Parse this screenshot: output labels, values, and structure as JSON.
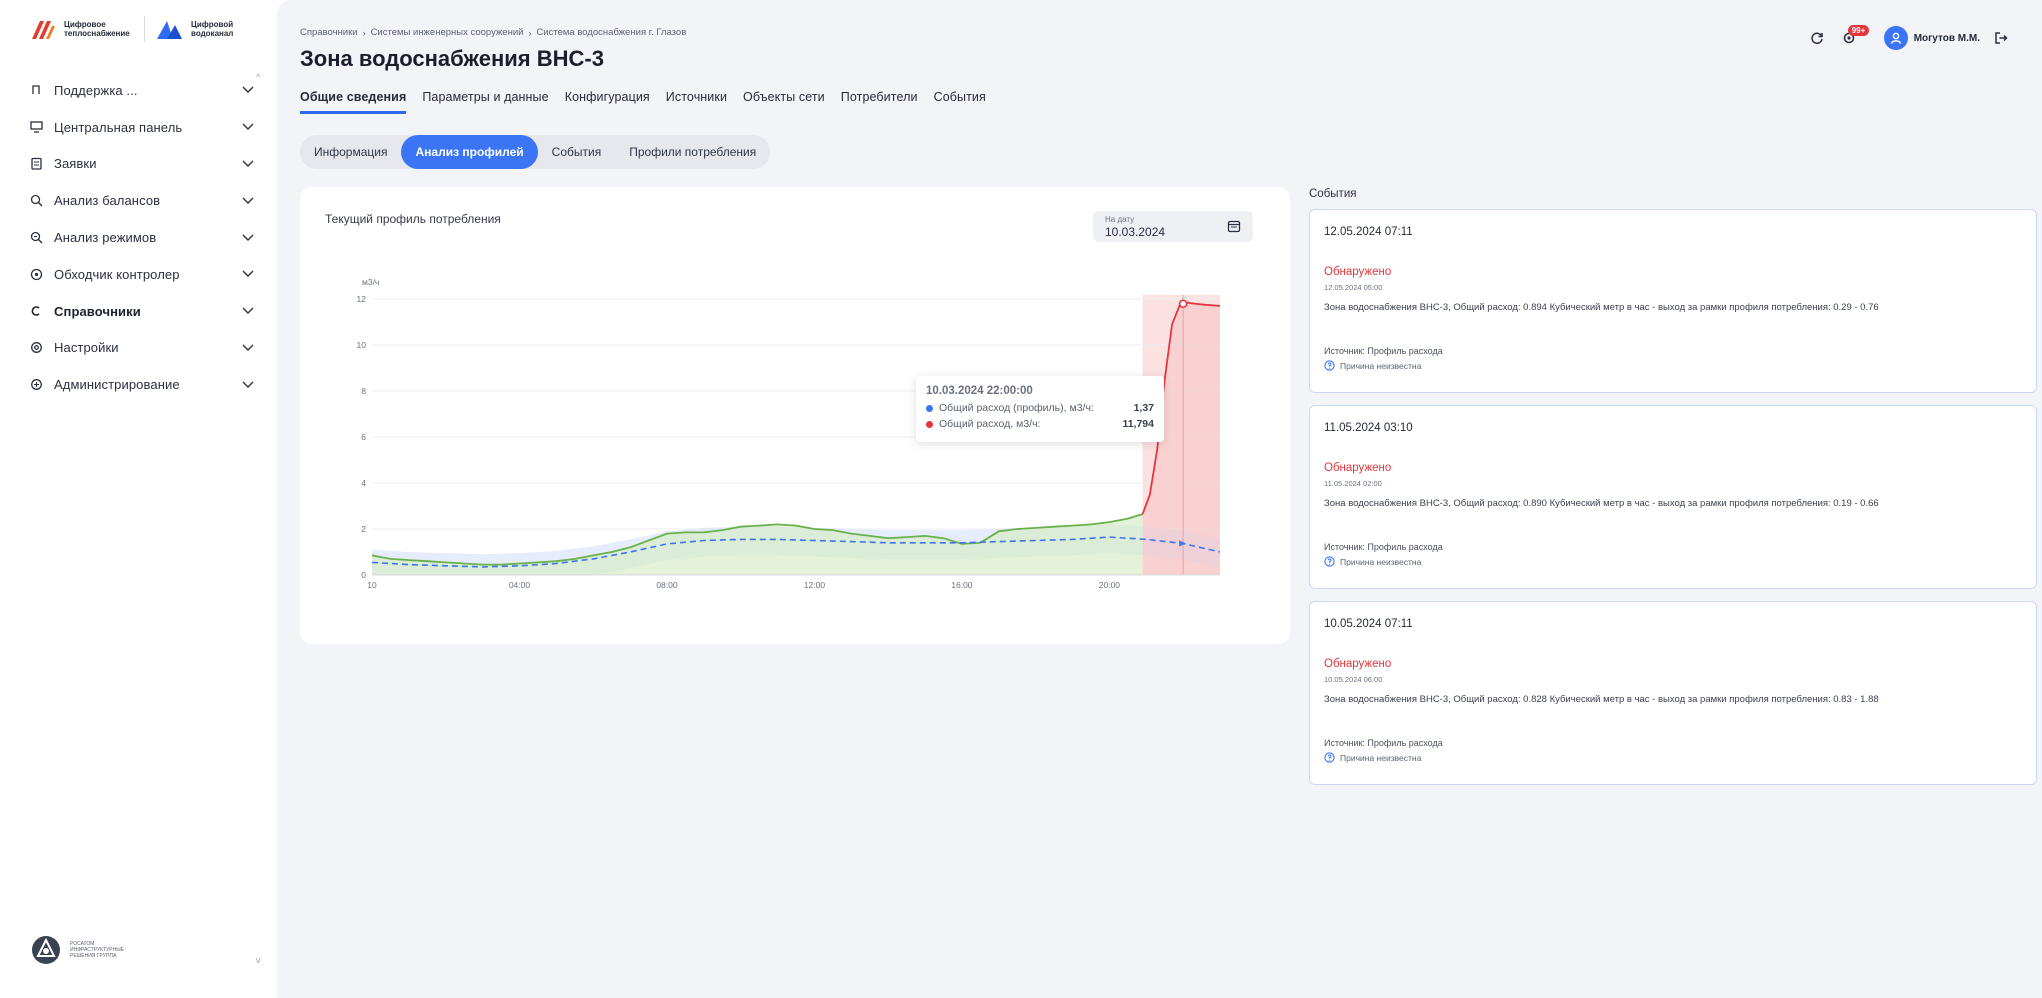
{
  "brand": {
    "logo1_text": "Цифровое теплоснабжение",
    "logo2_text": "Цифровой водоканал",
    "bottom_logo_text": "РОСАТОМ ИНФРАСТРУКТУРНЫЕ РЕШЕНИЯ ГРУППА"
  },
  "sidebar": {
    "items": [
      {
        "label": "Поддержка ...",
        "icon": "support-icon",
        "active": false
      },
      {
        "label": "Центральная панель",
        "icon": "monitor-icon",
        "active": false
      },
      {
        "label": "Заявки",
        "icon": "clipboard-icon",
        "active": false
      },
      {
        "label": "Анализ балансов",
        "icon": "balance-search-icon",
        "active": false
      },
      {
        "label": "Анализ режимов",
        "icon": "mode-search-icon",
        "active": false
      },
      {
        "label": "Обходчик контролер",
        "icon": "walker-icon",
        "active": false
      },
      {
        "label": "Справочники",
        "icon": "reference-icon",
        "active": true
      },
      {
        "label": "Настройки",
        "icon": "settings-icon",
        "active": false
      },
      {
        "label": "Администрирование",
        "icon": "admin-icon",
        "active": false
      }
    ]
  },
  "header": {
    "breadcrumb": [
      "Справочники",
      "Системы инженерных сооружений",
      "Система водоснабжения г. Глазов"
    ],
    "title": "Зона водоснабжения ВНС-3",
    "notifications_count": "99+",
    "user_name": "Могутов М.М."
  },
  "tabs": [
    "Общие сведения",
    "Параметры и данные",
    "Конфигурация",
    "Источники",
    "Объекты сети",
    "Потребители",
    "События"
  ],
  "subtabs": [
    "Информация",
    "Анализ профилей",
    "События",
    "Профили потребления"
  ],
  "chart_card": {
    "title": "Текущий профиль потребления",
    "date_label": "На дату",
    "date_value": "10.03.2024"
  },
  "tooltip": {
    "title": "10.03.2024 22:00:00",
    "rows": [
      {
        "label": "Общий расход (профиль), м3/ч:",
        "value": "1,37",
        "color": "#3b74f4"
      },
      {
        "label": "Общий расход, м3/ч:",
        "value": "11,794",
        "color": "#e5363d"
      }
    ]
  },
  "chart_data": {
    "type": "line",
    "ylabel": "м3/ч",
    "ylim": [
      0,
      12
    ],
    "yticks": [
      "0",
      "2",
      "4",
      "6",
      "8",
      "10",
      "12"
    ],
    "xlim": [
      0,
      23
    ],
    "xtick_labels": [
      {
        "x": 0,
        "label": "10"
      },
      {
        "x": 4,
        "label": "04:00"
      },
      {
        "x": 8,
        "label": "08:00"
      },
      {
        "x": 12,
        "label": "12:00"
      },
      {
        "x": 16,
        "label": "16:00"
      },
      {
        "x": 20,
        "label": "20:00"
      }
    ],
    "anomaly_from_x": 20.9,
    "series": [
      {
        "color": "#6ab04c",
        "style": "solid",
        "x": [
          0,
          0.5,
          1,
          1.5,
          2,
          2.5,
          3,
          3.5,
          4,
          4.5,
          5,
          5.5,
          6,
          6.5,
          7,
          7.5,
          8,
          8.5,
          9,
          9.5,
          10,
          10.5,
          11,
          11.5,
          12,
          12.5,
          13,
          13.5,
          14,
          14.5,
          15,
          15.5,
          16,
          16.5,
          17,
          17.5,
          18,
          18.5,
          19,
          19.5,
          20,
          20.5,
          20.9
        ],
        "y": [
          0.85,
          0.7,
          0.65,
          0.6,
          0.55,
          0.5,
          0.45,
          0.45,
          0.5,
          0.55,
          0.6,
          0.7,
          0.85,
          1.0,
          1.2,
          1.5,
          1.8,
          1.85,
          1.85,
          1.95,
          2.1,
          2.15,
          2.2,
          2.15,
          2.0,
          1.95,
          1.8,
          1.7,
          1.6,
          1.65,
          1.7,
          1.6,
          1.35,
          1.4,
          1.9,
          2.0,
          2.05,
          2.1,
          2.15,
          2.2,
          2.3,
          2.45,
          2.65
        ]
      },
      {
        "color": "#e5363d",
        "style": "solid",
        "x": [
          20.9,
          21.1,
          21.3,
          21.5,
          21.7,
          21.9,
          22.1,
          22.3,
          22.6,
          23
        ],
        "y": [
          2.65,
          3.5,
          5.5,
          8.5,
          10.9,
          11.7,
          11.85,
          11.8,
          11.75,
          11.7
        ]
      },
      {
        "color": "#3b74f4",
        "style": "dashed",
        "x": [
          0,
          1,
          2,
          3,
          4,
          5,
          6,
          7,
          8,
          9,
          10,
          11,
          12,
          13,
          14,
          15,
          16,
          17,
          18,
          19,
          20,
          21,
          22,
          23
        ],
        "y": [
          0.55,
          0.45,
          0.4,
          0.35,
          0.4,
          0.5,
          0.7,
          1.0,
          1.35,
          1.5,
          1.55,
          1.55,
          1.5,
          1.45,
          1.4,
          1.4,
          1.4,
          1.45,
          1.5,
          1.55,
          1.65,
          1.55,
          1.37,
          1.0
        ]
      }
    ]
  },
  "events_panel": {
    "title": "События",
    "items": [
      {
        "time": "12.05.2024 07:11",
        "status": "Обнаружено",
        "date": "12.05.2024 05:00",
        "desc": "Зона водоснабжения ВНС-3, Общий расход: 0.894 Кубический метр в час - выход за рамки профиля потребления: 0.29 - 0.76",
        "source": "Источник: Профиль расхода",
        "reason": "Причина неизвестна"
      },
      {
        "time": "11.05.2024 03:10",
        "status": "Обнаружено",
        "date": "11.05.2024 02:00",
        "desc": "Зона водоснабжения ВНС-3, Общий расход: 0.890 Кубический метр в час - выход за рамки профиля потребления: 0.19 - 0.66",
        "source": "Источник: Профиль расхода",
        "reason": "Причина неизвестна"
      },
      {
        "time": "10.05.2024 07:11",
        "status": "Обнаружено",
        "date": "10.05.2024 06:00",
        "desc": "Зона водоснабжения ВНС-3, Общий расход: 0.828 Кубический метр в час - выход за рамки профиля потребления: 0.83 - 1.88",
        "source": "Источник: Профиль расхода",
        "reason": "Причина неизвестна"
      }
    ]
  }
}
